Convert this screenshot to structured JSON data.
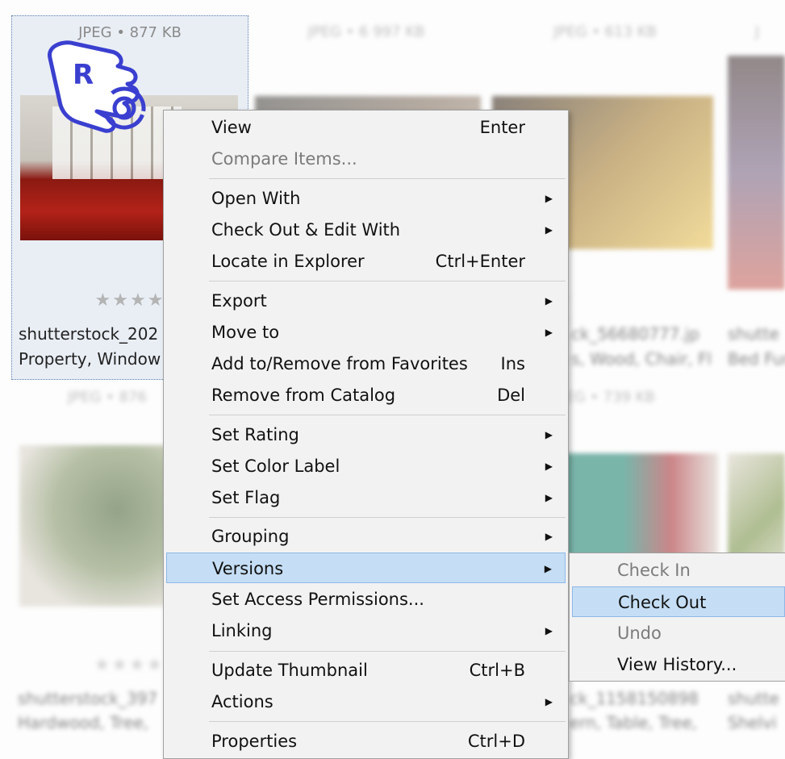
{
  "thumbnails": {
    "selected": {
      "meta": "JPEG • 877 KB",
      "stars": "★★★★",
      "filename": "shutterstock_202",
      "tags": "Property, Window"
    },
    "others": [
      {
        "meta": "JPEG • 6 997 KB"
      },
      {
        "meta": "JPEG • 613 KB"
      },
      {
        "meta": "J"
      },
      {
        "meta": "JPEG • 876"
      },
      {
        "meta": "JPEG • 739 KB"
      }
    ],
    "blurred_text": {
      "row1_stars": "★ ★ ★ ★",
      "row1_fname": "ck_56680777.jp",
      "row1_tags": "s, Wood, Chair, Fl",
      "row1_fname2": "shutte",
      "row1_tags2": "Bed Fur",
      "row2_stars": "★★★★",
      "row2_fname": "shutterstock_397",
      "row2_tags": "Hardwood, Tree,",
      "row2_fname_b": "ck_1158150898",
      "row2_tags_b": "ern, Table, Tree,",
      "row2_fname2": "shutte",
      "row2_tags2": "Shelvi"
    }
  },
  "cursor": {
    "letter": "R"
  },
  "context_menu": {
    "view": {
      "label": "View",
      "shortcut": "Enter"
    },
    "compare": {
      "label": "Compare Items..."
    },
    "open_with": {
      "label": "Open With"
    },
    "check_out_edit": {
      "label": "Check Out & Edit With"
    },
    "locate": {
      "label": "Locate in Explorer",
      "shortcut": "Ctrl+Enter"
    },
    "export": {
      "label": "Export"
    },
    "move_to": {
      "label": "Move to"
    },
    "favorites": {
      "label": "Add to/Remove from Favorites",
      "shortcut": "Ins"
    },
    "remove_catalog": {
      "label": "Remove from Catalog",
      "shortcut": "Del"
    },
    "set_rating": {
      "label": "Set Rating"
    },
    "set_color": {
      "label": "Set Color Label"
    },
    "set_flag": {
      "label": "Set Flag"
    },
    "grouping": {
      "label": "Grouping"
    },
    "versions": {
      "label": "Versions"
    },
    "access": {
      "label": "Set Access Permissions..."
    },
    "linking": {
      "label": "Linking"
    },
    "update_thumb": {
      "label": "Update Thumbnail",
      "shortcut": "Ctrl+B"
    },
    "actions": {
      "label": "Actions"
    },
    "properties": {
      "label": "Properties",
      "shortcut": "Ctrl+D"
    }
  },
  "versions_submenu": {
    "check_in": {
      "label": "Check In"
    },
    "check_out": {
      "label": "Check Out"
    },
    "undo": {
      "label": "Undo"
    },
    "view_history": {
      "label": "View History..."
    }
  },
  "colors": {
    "highlight": "#c5def5",
    "menu_bg": "#f2f2f2",
    "cursor_blue": "#3a3fd0"
  }
}
